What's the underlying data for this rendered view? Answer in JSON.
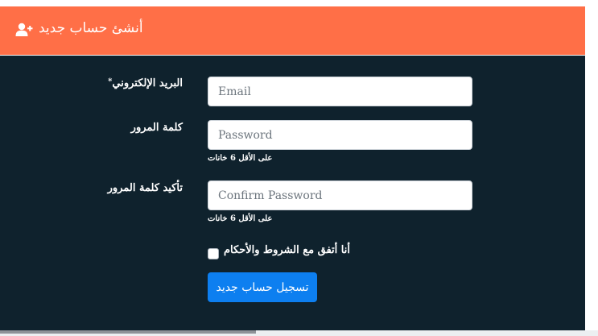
{
  "header": {
    "title": "أنشئ حساب جديد",
    "icon": "user-plus-icon",
    "background": "#ff6f47"
  },
  "form": {
    "email": {
      "label": "البريد الإلكتروني",
      "required_mark": "*",
      "placeholder": "Email",
      "value": ""
    },
    "password": {
      "label": "كلمة المرور",
      "placeholder": "Password",
      "value": "",
      "hint": "على الأقل 6 خانات"
    },
    "confirm_password": {
      "label": "تأكيد كلمة المرور",
      "placeholder": "Confirm Password",
      "value": "",
      "hint": "على الأقل 6 خانات"
    },
    "terms": {
      "label": "أنا أتفق مع الشروط والأحكام",
      "checked": false
    },
    "submit_label": "تسجيل حساب جديد"
  },
  "colors": {
    "panel_bg": "#0f222d",
    "button": "#0d7ff0",
    "text": "#ffffff"
  }
}
